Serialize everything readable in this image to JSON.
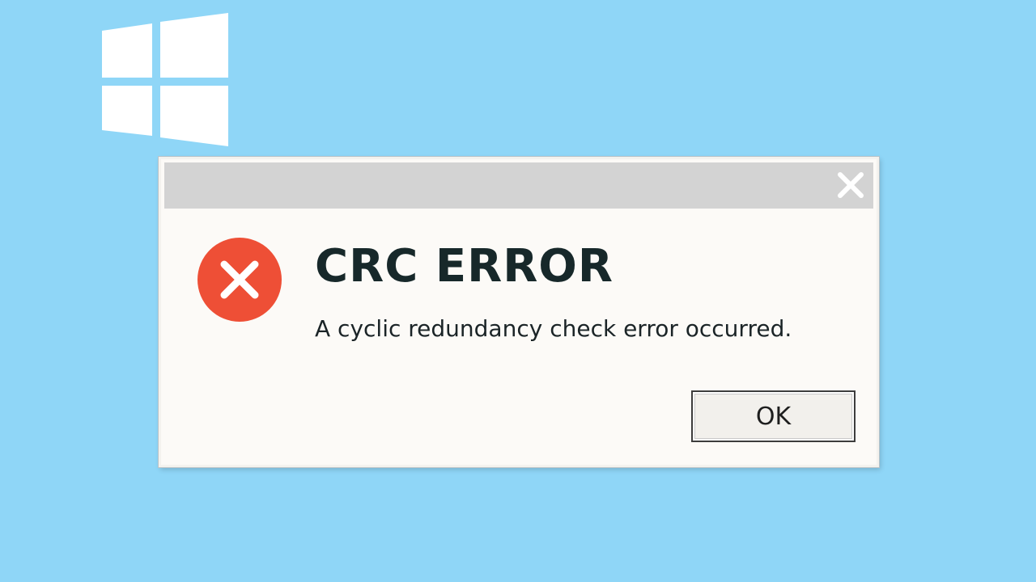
{
  "desktop": {
    "background_color": "#8fd6f7",
    "logo_icon": "windows-logo-icon"
  },
  "dialog": {
    "close_icon": "close-icon",
    "error_icon": "error-circle-x-icon",
    "error_color": "#ee4f36",
    "title": "CRC ERROR",
    "message": "A cyclic redundancy check error occurred.",
    "ok_label": "OK"
  }
}
